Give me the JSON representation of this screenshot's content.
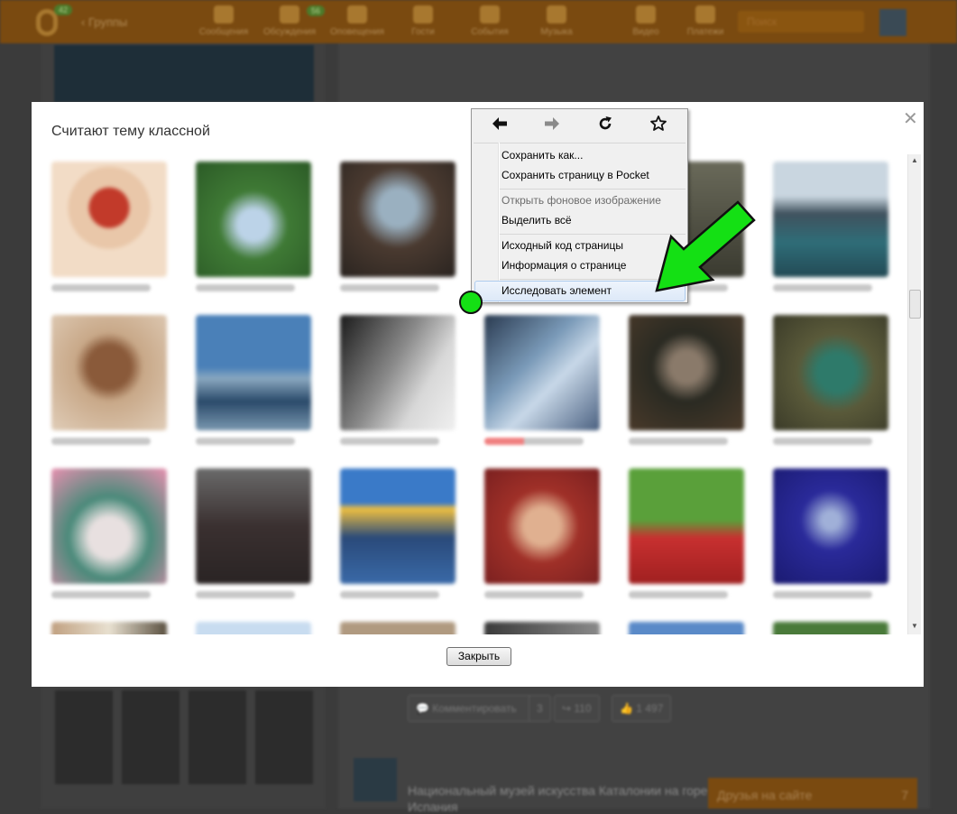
{
  "background": {
    "topbar": {
      "logo_badge": "42",
      "groups_label": "Группы",
      "nav": [
        {
          "label": "Сообщения",
          "icon": "envelope-icon"
        },
        {
          "label": "Обсуждения",
          "icon": "chat-icon",
          "badge": "56"
        },
        {
          "label": "Оповещения",
          "icon": "bell-icon"
        },
        {
          "label": "Гости",
          "icon": "footprints-icon"
        },
        {
          "label": "События",
          "icon": "events-icon"
        },
        {
          "label": "Музыка",
          "icon": "music-icon"
        },
        {
          "label": "Видео",
          "icon": "video-icon"
        },
        {
          "label": "Платежи",
          "icon": "wallet-icon"
        }
      ],
      "search_placeholder": "Поиск"
    },
    "post_actions": {
      "comment_label": "Комментировать",
      "comment_count": "3",
      "reshare_count": "110",
      "likes_count": "1 497"
    },
    "news_text": "Национальный музей искусства Каталонии на горе",
    "news_text2": "Испания",
    "friends_bar": {
      "label": "Друзья на сайте",
      "count": "7"
    }
  },
  "modal": {
    "title": "Считают тему классной",
    "close_button_label": "Закрыть"
  },
  "context_menu": {
    "nav": [
      {
        "name": "back",
        "glyph": "🡐",
        "enabled": true
      },
      {
        "name": "forward",
        "glyph": "🡒",
        "enabled": false
      },
      {
        "name": "reload",
        "glyph": "↻",
        "enabled": true
      },
      {
        "name": "bookmark",
        "glyph": "☆",
        "enabled": true
      }
    ],
    "items": [
      {
        "label": "Сохранить как...",
        "disabled": false
      },
      {
        "label": "Сохранить страницу в Pocket",
        "disabled": false
      },
      {
        "label": "Открыть фоновое изображение",
        "disabled": true
      },
      {
        "label": "Выделить всё",
        "disabled": false
      },
      {
        "label": "Исходный код страницы",
        "disabled": false
      },
      {
        "label": "Информация о странице",
        "disabled": false
      },
      {
        "label": "Исследовать элемент",
        "disabled": false,
        "highlighted": true
      }
    ]
  },
  "colors": {
    "annotation_green": "#14e014",
    "ok_orange": "#ee8208"
  }
}
